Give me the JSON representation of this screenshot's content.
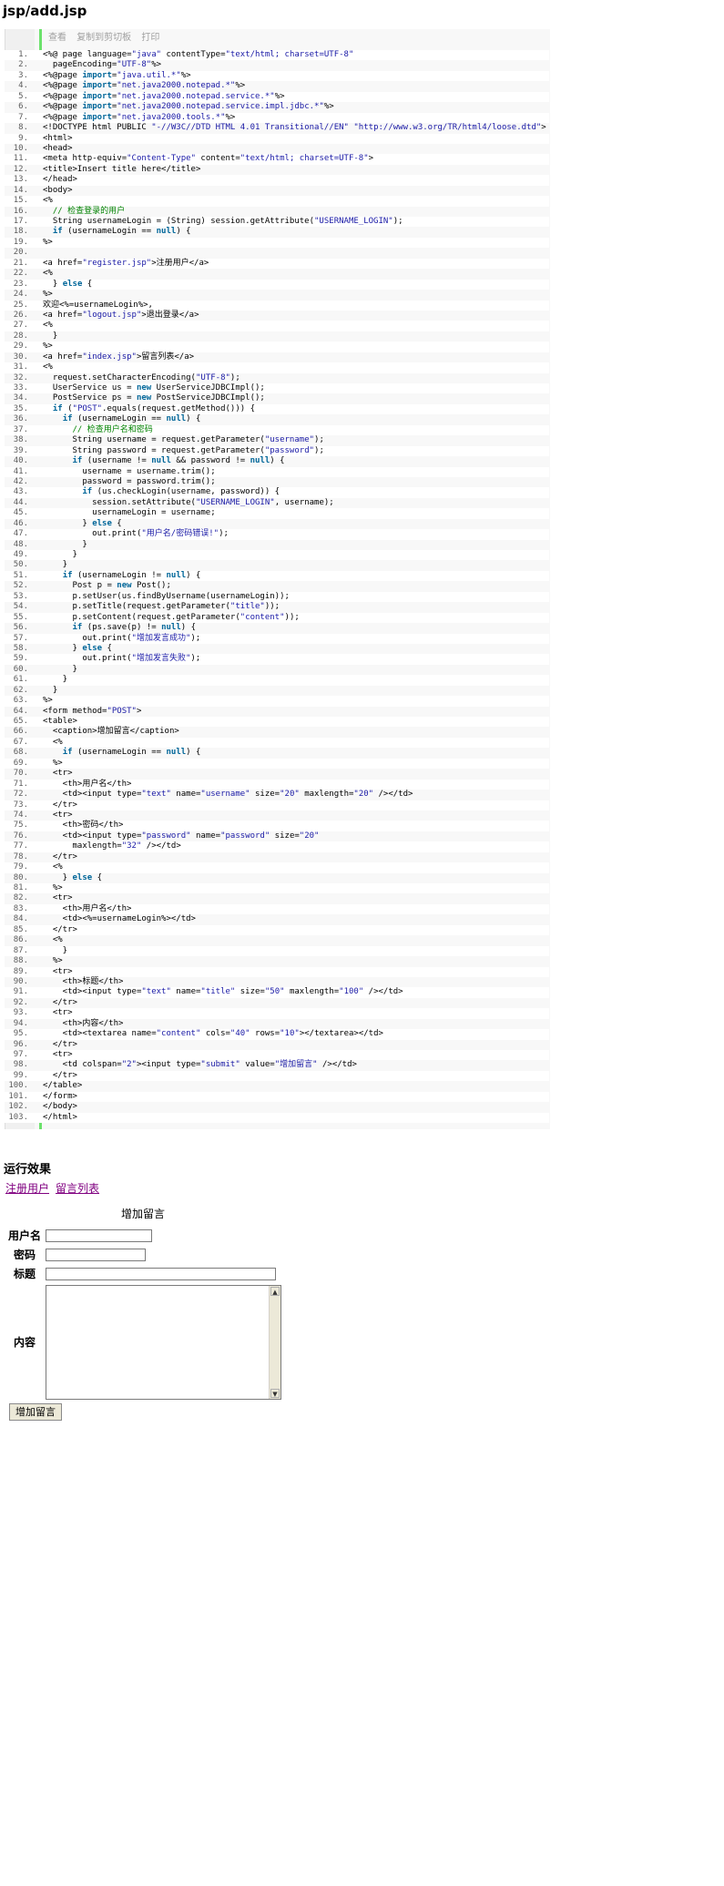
{
  "page": {
    "title": "jsp/add.jsp"
  },
  "code": {
    "tools": [
      "查看",
      "复制到剪切板",
      "打印"
    ],
    "lines": [
      [
        [
          "t",
          "<%@ page language="
        ],
        [
          "s",
          "\"java\""
        ],
        [
          "t",
          " contentType="
        ],
        [
          "s",
          "\"text/html; charset=UTF-8\""
        ]
      ],
      [
        [
          "t",
          "  pageEncoding="
        ],
        [
          "s",
          "\"UTF-8\""
        ],
        [
          "t",
          "%>"
        ]
      ],
      [
        [
          "t",
          "<%@page "
        ],
        [
          "k",
          "import"
        ],
        [
          "t",
          "="
        ],
        [
          "s",
          "\"java.util.*\""
        ],
        [
          "t",
          "%>"
        ]
      ],
      [
        [
          "t",
          "<%@page "
        ],
        [
          "k",
          "import"
        ],
        [
          "t",
          "="
        ],
        [
          "s",
          "\"net.java2000.notepad.*\""
        ],
        [
          "t",
          "%>"
        ]
      ],
      [
        [
          "t",
          "<%@page "
        ],
        [
          "k",
          "import"
        ],
        [
          "t",
          "="
        ],
        [
          "s",
          "\"net.java2000.notepad.service.*\""
        ],
        [
          "t",
          "%>"
        ]
      ],
      [
        [
          "t",
          "<%@page "
        ],
        [
          "k",
          "import"
        ],
        [
          "t",
          "="
        ],
        [
          "s",
          "\"net.java2000.notepad.service.impl.jdbc.*\""
        ],
        [
          "t",
          "%>"
        ]
      ],
      [
        [
          "t",
          "<%@page "
        ],
        [
          "k",
          "import"
        ],
        [
          "t",
          "="
        ],
        [
          "s",
          "\"net.java2000.tools.*\""
        ],
        [
          "t",
          "%>"
        ]
      ],
      [
        [
          "t",
          "<!DOCTYPE html PUBLIC "
        ],
        [
          "s",
          "\"-//W3C//DTD HTML 4.01 Transitional//EN\""
        ],
        [
          "t",
          " "
        ],
        [
          "s",
          "\"http://www.w3.org/TR/html4/loose.dtd\""
        ],
        [
          "t",
          ">"
        ]
      ],
      [
        [
          "t",
          "<html>"
        ]
      ],
      [
        [
          "t",
          "<head>"
        ]
      ],
      [
        [
          "t",
          "<meta http-equiv="
        ],
        [
          "s",
          "\"Content-Type\""
        ],
        [
          "t",
          " content="
        ],
        [
          "s",
          "\"text/html; charset=UTF-8\""
        ],
        [
          "t",
          ">"
        ]
      ],
      [
        [
          "t",
          "<title>Insert title here</title>"
        ]
      ],
      [
        [
          "t",
          "</head>"
        ]
      ],
      [
        [
          "t",
          "<body>"
        ]
      ],
      [
        [
          "t",
          "<%"
        ]
      ],
      [
        [
          "t",
          "  "
        ],
        [
          "c",
          "// 检查登录的用户"
        ]
      ],
      [
        [
          "t",
          "  String usernameLogin = (String) session.getAttribute("
        ],
        [
          "s",
          "\"USERNAME_LOGIN\""
        ],
        [
          "t",
          ");"
        ]
      ],
      [
        [
          "t",
          "  "
        ],
        [
          "k",
          "if"
        ],
        [
          "t",
          " (usernameLogin == "
        ],
        [
          "k",
          "null"
        ],
        [
          "t",
          ") {"
        ]
      ],
      [
        [
          "t",
          "%>"
        ]
      ],
      [
        [
          "t",
          ""
        ]
      ],
      [
        [
          "t",
          "<a href="
        ],
        [
          "s",
          "\"register.jsp\""
        ],
        [
          "t",
          ">注册用户</a>"
        ]
      ],
      [
        [
          "t",
          "<%"
        ]
      ],
      [
        [
          "t",
          "  } "
        ],
        [
          "k",
          "else"
        ],
        [
          "t",
          " {"
        ]
      ],
      [
        [
          "t",
          "%>"
        ]
      ],
      [
        [
          "t",
          "欢迎<%=usernameLogin%>,"
        ]
      ],
      [
        [
          "t",
          "<a href="
        ],
        [
          "s",
          "\"logout.jsp\""
        ],
        [
          "t",
          ">退出登录</a>"
        ]
      ],
      [
        [
          "t",
          "<%"
        ]
      ],
      [
        [
          "t",
          "  }"
        ]
      ],
      [
        [
          "t",
          "%>"
        ]
      ],
      [
        [
          "t",
          "<a href="
        ],
        [
          "s",
          "\"index.jsp\""
        ],
        [
          "t",
          ">留言列表</a>"
        ]
      ],
      [
        [
          "t",
          "<%"
        ]
      ],
      [
        [
          "t",
          "  request.setCharacterEncoding("
        ],
        [
          "s",
          "\"UTF-8\""
        ],
        [
          "t",
          ");"
        ]
      ],
      [
        [
          "t",
          "  UserService us = "
        ],
        [
          "k",
          "new"
        ],
        [
          "t",
          " UserServiceJDBCImpl();"
        ]
      ],
      [
        [
          "t",
          "  PostService ps = "
        ],
        [
          "k",
          "new"
        ],
        [
          "t",
          " PostServiceJDBCImpl();"
        ]
      ],
      [
        [
          "t",
          "  "
        ],
        [
          "k",
          "if"
        ],
        [
          "t",
          " ("
        ],
        [
          "s",
          "\"POST\""
        ],
        [
          "t",
          ".equals(request.getMethod())) {"
        ]
      ],
      [
        [
          "t",
          "    "
        ],
        [
          "k",
          "if"
        ],
        [
          "t",
          " (usernameLogin == "
        ],
        [
          "k",
          "null"
        ],
        [
          "t",
          ") {"
        ]
      ],
      [
        [
          "t",
          "      "
        ],
        [
          "c",
          "// 检查用户名和密码"
        ]
      ],
      [
        [
          "t",
          "      String username = request.getParameter("
        ],
        [
          "s",
          "\"username\""
        ],
        [
          "t",
          ");"
        ]
      ],
      [
        [
          "t",
          "      String password = request.getParameter("
        ],
        [
          "s",
          "\"password\""
        ],
        [
          "t",
          ");"
        ]
      ],
      [
        [
          "t",
          "      "
        ],
        [
          "k",
          "if"
        ],
        [
          "t",
          " (username != "
        ],
        [
          "k",
          "null"
        ],
        [
          "t",
          " && password != "
        ],
        [
          "k",
          "null"
        ],
        [
          "t",
          ") {"
        ]
      ],
      [
        [
          "t",
          "        username = username.trim();"
        ]
      ],
      [
        [
          "t",
          "        password = password.trim();"
        ]
      ],
      [
        [
          "t",
          "        "
        ],
        [
          "k",
          "if"
        ],
        [
          "t",
          " (us.checkLogin(username, password)) {"
        ]
      ],
      [
        [
          "t",
          "          session.setAttribute("
        ],
        [
          "s",
          "\"USERNAME_LOGIN\""
        ],
        [
          "t",
          ", username);"
        ]
      ],
      [
        [
          "t",
          "          usernameLogin = username;"
        ]
      ],
      [
        [
          "t",
          "        } "
        ],
        [
          "k",
          "else"
        ],
        [
          "t",
          " {"
        ]
      ],
      [
        [
          "t",
          "          out.print("
        ],
        [
          "s",
          "\"用户名/密码错误!\""
        ],
        [
          "t",
          ");"
        ]
      ],
      [
        [
          "t",
          "        }"
        ]
      ],
      [
        [
          "t",
          "      }"
        ]
      ],
      [
        [
          "t",
          "    }"
        ]
      ],
      [
        [
          "t",
          "    "
        ],
        [
          "k",
          "if"
        ],
        [
          "t",
          " (usernameLogin != "
        ],
        [
          "k",
          "null"
        ],
        [
          "t",
          ") {"
        ]
      ],
      [
        [
          "t",
          "      Post p = "
        ],
        [
          "k",
          "new"
        ],
        [
          "t",
          " Post();"
        ]
      ],
      [
        [
          "t",
          "      p.setUser(us.findByUsername(usernameLogin));"
        ]
      ],
      [
        [
          "t",
          "      p.setTitle(request.getParameter("
        ],
        [
          "s",
          "\"title\""
        ],
        [
          "t",
          "));"
        ]
      ],
      [
        [
          "t",
          "      p.setContent(request.getParameter("
        ],
        [
          "s",
          "\"content\""
        ],
        [
          "t",
          "));"
        ]
      ],
      [
        [
          "t",
          "      "
        ],
        [
          "k",
          "if"
        ],
        [
          "t",
          " (ps.save(p) != "
        ],
        [
          "k",
          "null"
        ],
        [
          "t",
          ") {"
        ]
      ],
      [
        [
          "t",
          "        out.print("
        ],
        [
          "s",
          "\"增加发言成功\""
        ],
        [
          "t",
          ");"
        ]
      ],
      [
        [
          "t",
          "      } "
        ],
        [
          "k",
          "else"
        ],
        [
          "t",
          " {"
        ]
      ],
      [
        [
          "t",
          "        out.print("
        ],
        [
          "s",
          "\"增加发言失败\""
        ],
        [
          "t",
          ");"
        ]
      ],
      [
        [
          "t",
          "      }"
        ]
      ],
      [
        [
          "t",
          "    }"
        ]
      ],
      [
        [
          "t",
          "  }"
        ]
      ],
      [
        [
          "t",
          "%>"
        ]
      ],
      [
        [
          "t",
          "<form method="
        ],
        [
          "s",
          "\"POST\""
        ],
        [
          "t",
          ">"
        ]
      ],
      [
        [
          "t",
          "<table>"
        ]
      ],
      [
        [
          "t",
          "  <caption>增加留言</caption>"
        ]
      ],
      [
        [
          "t",
          "  <%"
        ]
      ],
      [
        [
          "t",
          "    "
        ],
        [
          "k",
          "if"
        ],
        [
          "t",
          " (usernameLogin == "
        ],
        [
          "k",
          "null"
        ],
        [
          "t",
          ") {"
        ]
      ],
      [
        [
          "t",
          "  %>"
        ]
      ],
      [
        [
          "t",
          "  <tr>"
        ]
      ],
      [
        [
          "t",
          "    <th>用户名</th>"
        ]
      ],
      [
        [
          "t",
          "    <td><input type="
        ],
        [
          "s",
          "\"text\""
        ],
        [
          "t",
          " name="
        ],
        [
          "s",
          "\"username\""
        ],
        [
          "t",
          " size="
        ],
        [
          "s",
          "\"20\""
        ],
        [
          "t",
          " maxlength="
        ],
        [
          "s",
          "\"20\""
        ],
        [
          "t",
          " /></td>"
        ]
      ],
      [
        [
          "t",
          "  </tr>"
        ]
      ],
      [
        [
          "t",
          "  <tr>"
        ]
      ],
      [
        [
          "t",
          "    <th>密码</th>"
        ]
      ],
      [
        [
          "t",
          "    <td><input type="
        ],
        [
          "s",
          "\"password\""
        ],
        [
          "t",
          " name="
        ],
        [
          "s",
          "\"password\""
        ],
        [
          "t",
          " size="
        ],
        [
          "s",
          "\"20\""
        ]
      ],
      [
        [
          "t",
          "      maxlength="
        ],
        [
          "s",
          "\"32\""
        ],
        [
          "t",
          " /></td>"
        ]
      ],
      [
        [
          "t",
          "  </tr>"
        ]
      ],
      [
        [
          "t",
          "  <%"
        ]
      ],
      [
        [
          "t",
          "    } "
        ],
        [
          "k",
          "else"
        ],
        [
          "t",
          " {"
        ]
      ],
      [
        [
          "t",
          "  %>"
        ]
      ],
      [
        [
          "t",
          "  <tr>"
        ]
      ],
      [
        [
          "t",
          "    <th>用户名</th>"
        ]
      ],
      [
        [
          "t",
          "    <td><%=usernameLogin%></td>"
        ]
      ],
      [
        [
          "t",
          "  </tr>"
        ]
      ],
      [
        [
          "t",
          "  <%"
        ]
      ],
      [
        [
          "t",
          "    }"
        ]
      ],
      [
        [
          "t",
          "  %>"
        ]
      ],
      [
        [
          "t",
          "  <tr>"
        ]
      ],
      [
        [
          "t",
          "    <th>标题</th>"
        ]
      ],
      [
        [
          "t",
          "    <td><input type="
        ],
        [
          "s",
          "\"text\""
        ],
        [
          "t",
          " name="
        ],
        [
          "s",
          "\"title\""
        ],
        [
          "t",
          " size="
        ],
        [
          "s",
          "\"50\""
        ],
        [
          "t",
          " maxlength="
        ],
        [
          "s",
          "\"100\""
        ],
        [
          "t",
          " /></td>"
        ]
      ],
      [
        [
          "t",
          "  </tr>"
        ]
      ],
      [
        [
          "t",
          "  <tr>"
        ]
      ],
      [
        [
          "t",
          "    <th>内容</th>"
        ]
      ],
      [
        [
          "t",
          "    <td><textarea name="
        ],
        [
          "s",
          "\"content\""
        ],
        [
          "t",
          " cols="
        ],
        [
          "s",
          "\"40\""
        ],
        [
          "t",
          " rows="
        ],
        [
          "s",
          "\"10\""
        ],
        [
          "t",
          "></textarea></td>"
        ]
      ],
      [
        [
          "t",
          "  </tr>"
        ]
      ],
      [
        [
          "t",
          "  <tr>"
        ]
      ],
      [
        [
          "t",
          "    <td colspan="
        ],
        [
          "s",
          "\"2\""
        ],
        [
          "t",
          "><input type="
        ],
        [
          "s",
          "\"submit\""
        ],
        [
          "t",
          " value="
        ],
        [
          "s",
          "\"增加留言\""
        ],
        [
          "t",
          " /></td>"
        ]
      ],
      [
        [
          "t",
          "  </tr>"
        ]
      ],
      [
        [
          "t",
          "</table>"
        ]
      ],
      [
        [
          "t",
          "</form>"
        ]
      ],
      [
        [
          "t",
          "</body>"
        ]
      ],
      [
        [
          "t",
          "</html>"
        ]
      ]
    ]
  },
  "result": {
    "heading": "运行效果",
    "links": {
      "register": "注册用户",
      "list": "留言列表"
    },
    "form": {
      "caption": "增加留言",
      "username_label": "用户名",
      "password_label": "密码",
      "title_label": "标题",
      "content_label": "内容",
      "submit_label": "增加留言"
    }
  }
}
